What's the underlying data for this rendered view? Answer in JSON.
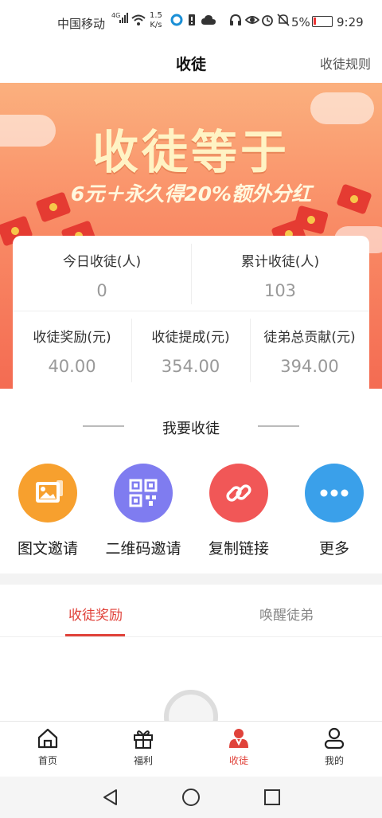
{
  "status_bar": {
    "carrier": "中国移动",
    "signal_label": "⁴ᴳ",
    "net_speed_value": "1.5",
    "net_speed_unit": "K/s",
    "battery": "5%",
    "time": "9:29"
  },
  "header": {
    "title": "收徒",
    "rules_link": "收徒规则"
  },
  "banner": {
    "headline": "收徒等于",
    "subline": "6元＋永久得20%额外分红"
  },
  "stats": {
    "today_label": "今日收徒(人)",
    "today_value": "0",
    "total_label": "累计收徒(人)",
    "total_value": "103",
    "reward_label": "收徒奖励(元)",
    "reward_value": "40.00",
    "commission_label": "收徒提成(元)",
    "commission_value": "354.00",
    "contribution_label": "徒弟总贡献(元)",
    "contribution_value": "394.00"
  },
  "invite": {
    "heading": "我要收徒",
    "actions": [
      {
        "label": "图文邀请",
        "icon": "image-icon",
        "color": "#f7a02e"
      },
      {
        "label": "二维码邀请",
        "icon": "qr-code-icon",
        "color": "#7f7cf0"
      },
      {
        "label": "复制链接",
        "icon": "link-icon",
        "color": "#f15757"
      },
      {
        "label": "更多",
        "icon": "more-icon",
        "color": "#3aa0ea"
      }
    ]
  },
  "tabs": {
    "reward": "收徒奖励",
    "wake": "唤醒徒弟"
  },
  "bottom_nav": {
    "home": "首页",
    "welfare": "福利",
    "apprentice": "收徒",
    "mine": "我的"
  },
  "colors": {
    "accent": "#e0423a"
  }
}
